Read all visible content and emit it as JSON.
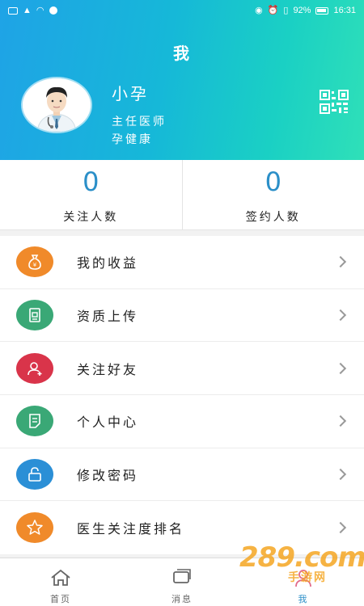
{
  "status_bar": {
    "battery": "92%",
    "time": "16:31"
  },
  "header": {
    "title": "我",
    "user": {
      "name": "小孕",
      "title": "主任医师",
      "org": "孕健康"
    },
    "icons": {
      "avatar": "doctor-avatar",
      "qr": "qr-code-icon"
    }
  },
  "stats": [
    {
      "value": "0",
      "label": "关注人数"
    },
    {
      "value": "0",
      "label": "签约人数"
    }
  ],
  "menu": [
    {
      "label": "我的收益",
      "icon": "money-bag-icon",
      "color": "#f08a2a"
    },
    {
      "label": "资质上传",
      "icon": "certificate-icon",
      "color": "#3aa876"
    },
    {
      "label": "关注好友",
      "icon": "add-friend-icon",
      "color": "#d9344a"
    },
    {
      "label": "个人中心",
      "icon": "profile-doc-icon",
      "color": "#3aa876"
    },
    {
      "label": "修改密码",
      "icon": "lock-icon",
      "color": "#2b8fd6"
    },
    {
      "label": "医生关注度排名",
      "icon": "star-icon",
      "color": "#f08a2a"
    }
  ],
  "tabs": [
    {
      "label": "首页",
      "icon": "home-icon",
      "active": false
    },
    {
      "label": "消息",
      "icon": "message-icon",
      "active": false
    },
    {
      "label": "我",
      "icon": "person-icon",
      "active": true
    }
  ],
  "watermark": {
    "main": "289.com",
    "sub": "手游网"
  },
  "colors": {
    "accent": "#2b8fc8",
    "header_start": "#1fa3e6",
    "header_end": "#2fe0b8"
  }
}
